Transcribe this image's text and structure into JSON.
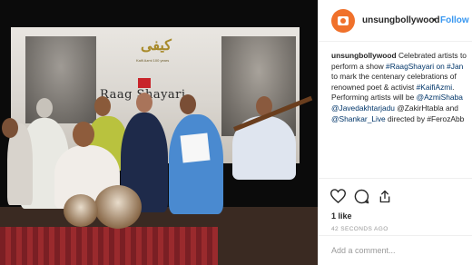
{
  "post": {
    "username": "unsungbollywood",
    "follow_dot": "•",
    "follow_label": "Follow"
  },
  "photo": {
    "urdu_logo": "کیفی",
    "logo_subtitle": "Kaifi Azmi 100 years",
    "event_title": "Raag Shayari"
  },
  "caption": {
    "lines": [
      {
        "text": "unsungbollywood",
        "kind": "user",
        "rest": " Celebrated artists to"
      },
      {
        "text": "perform a show ",
        "tag": "#RaagShayari",
        "rest": " on #Jan"
      },
      {
        "text": "to mark the centenary celebrations of",
        "tag": "",
        "rest": ""
      },
      {
        "text": "renowned poet & activist ",
        "tag": "#KaifiAzmi",
        "rest": "."
      },
      {
        "text": "Performing artists will be ",
        "tag": "@AzmiShaba",
        "rest": ""
      },
      {
        "text": "",
        "tag": "@Javedakhtarjadu",
        "rest": " @ZakirHtabla and"
      },
      {
        "text": "",
        "tag": "@Shankar_Live",
        "rest": " directed by #FerozAbb"
      }
    ]
  },
  "engagement": {
    "likes": "1 like",
    "timestamp": "42 SECONDS AGO"
  },
  "comment": {
    "placeholder": "Add a comment..."
  },
  "icons": {
    "like": "heart-icon",
    "comment": "speech-bubble-icon",
    "share": "share-arrow-icon"
  }
}
